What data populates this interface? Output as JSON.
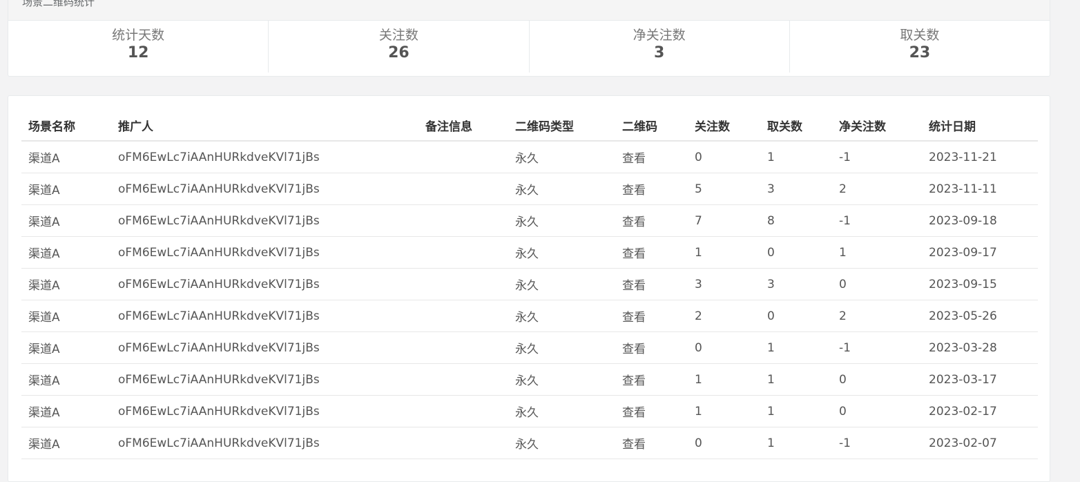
{
  "summary": {
    "title": "场景二维码统计",
    "stats": [
      {
        "label": "统计天数",
        "value": "12"
      },
      {
        "label": "关注数",
        "value": "26"
      },
      {
        "label": "净关注数",
        "value": "3"
      },
      {
        "label": "取关数",
        "value": "23"
      }
    ]
  },
  "table": {
    "headers": [
      "场景名称",
      "推广人",
      "备注信息",
      "二维码类型",
      "二维码",
      "关注数",
      "取关数",
      "净关注数",
      "统计日期"
    ],
    "rows": [
      [
        "渠道A",
        "oFM6EwLc7iAAnHURkdveKVl71jBs",
        "",
        "永久",
        "查看",
        "0",
        "1",
        "-1",
        "2023-11-21"
      ],
      [
        "渠道A",
        "oFM6EwLc7iAAnHURkdveKVl71jBs",
        "",
        "永久",
        "查看",
        "5",
        "3",
        "2",
        "2023-11-11"
      ],
      [
        "渠道A",
        "oFM6EwLc7iAAnHURkdveKVl71jBs",
        "",
        "永久",
        "查看",
        "7",
        "8",
        "-1",
        "2023-09-18"
      ],
      [
        "渠道A",
        "oFM6EwLc7iAAnHURkdveKVl71jBs",
        "",
        "永久",
        "查看",
        "1",
        "0",
        "1",
        "2023-09-17"
      ],
      [
        "渠道A",
        "oFM6EwLc7iAAnHURkdveKVl71jBs",
        "",
        "永久",
        "查看",
        "3",
        "3",
        "0",
        "2023-09-15"
      ],
      [
        "渠道A",
        "oFM6EwLc7iAAnHURkdveKVl71jBs",
        "",
        "永久",
        "查看",
        "2",
        "0",
        "2",
        "2023-05-26"
      ],
      [
        "渠道A",
        "oFM6EwLc7iAAnHURkdveKVl71jBs",
        "",
        "永久",
        "查看",
        "0",
        "1",
        "-1",
        "2023-03-28"
      ],
      [
        "渠道A",
        "oFM6EwLc7iAAnHURkdveKVl71jBs",
        "",
        "永久",
        "查看",
        "1",
        "1",
        "0",
        "2023-03-17"
      ],
      [
        "渠道A",
        "oFM6EwLc7iAAnHURkdveKVl71jBs",
        "",
        "永久",
        "查看",
        "1",
        "1",
        "0",
        "2023-02-17"
      ],
      [
        "渠道A",
        "oFM6EwLc7iAAnHURkdveKVl71jBs",
        "",
        "永久",
        "查看",
        "0",
        "1",
        "-1",
        "2023-02-07"
      ]
    ]
  }
}
